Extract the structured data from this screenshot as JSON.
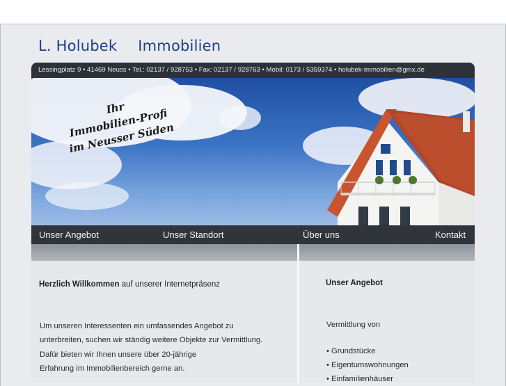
{
  "header": {
    "brand_part1": "L. Holubek",
    "brand_part2": "Immobilien",
    "contact_line": "Lessingplatz 9 • 41469 Neuss • Tel.: 02137 / 928753 • Fax: 02137 / 928763 • Mobil: 0173 / 5359374 • holubek-immobilien@gmx.de"
  },
  "hero": {
    "slogan_line1": "Ihr",
    "slogan_line2": "Immobilien-Profi",
    "slogan_line3": "im Neusser Süden"
  },
  "nav": {
    "items": [
      "Unser Angebot",
      "Unser Standort",
      "Über uns",
      "Kontakt"
    ]
  },
  "left_column": {
    "welcome_bold": "Herzlich Willkommen",
    "welcome_rest": " auf unserer Internetpräsenz",
    "paragraph_lines": [
      "Um unseren Interessenten ein umfassendes Angebot zu",
      "unterbreiten, suchen wir ständig weitere Objekte zur Vermittlung.",
      "Dafür bieten wir Ihnen unsere über 20-jährige",
      "Erfahrung im Immobilienbereich gerne an."
    ]
  },
  "right_column": {
    "heading": "Unser Angebot",
    "intro": "Vermittlung von",
    "items": [
      "Grundstücke",
      "Eigentumswohnungen",
      "Einfamilienhäuser"
    ]
  },
  "colors": {
    "brand_blue": "#1f3d8a",
    "bar_dark": "#2d3238",
    "panel_bg": "#e6e8eb"
  }
}
